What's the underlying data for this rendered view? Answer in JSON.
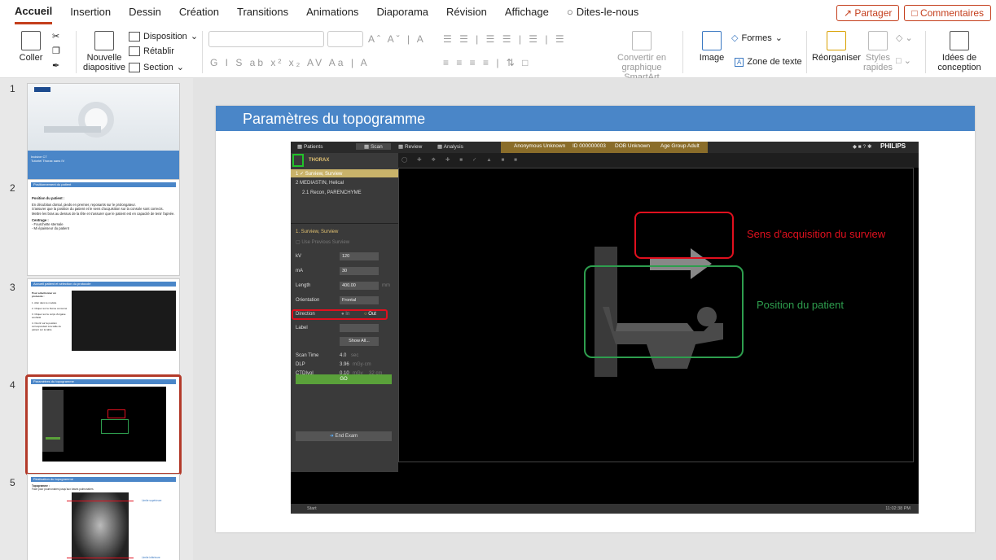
{
  "tabs": [
    "Accueil",
    "Insertion",
    "Dessin",
    "Création",
    "Transitions",
    "Animations",
    "Diaporama",
    "Révision",
    "Affichage",
    "Dites-le-nous"
  ],
  "top_buttons": {
    "share": "Partager",
    "comments": "Commentaires"
  },
  "ribbon": {
    "paste": "Coller",
    "new_slide_line1": "Nouvelle",
    "new_slide_line2": "diapositive",
    "layout": "Disposition",
    "reset": "Rétablir",
    "section": "Section",
    "format_row1": "Aˆ Aˇ | A",
    "format_row2": "G I S ab x² x₂ AV Aa | A",
    "smartart_line1": "Convertir en",
    "smartart_line2": "graphique SmartArt",
    "image": "Image",
    "shapes": "Formes",
    "textbox": "Zone de texte",
    "arrange": "Réorganiser",
    "quick_styles_line1": "Styles",
    "quick_styles_line2": "rapides",
    "design_line1": "Idées de",
    "design_line2": "conception"
  },
  "thumbnails": [
    {
      "num": "1",
      "lines": [
        "Incisive CT",
        "Tutoriel Thorax sans IV"
      ],
      "bar": ""
    },
    {
      "num": "2",
      "bar": "Positionnement du patient",
      "lines": [
        "Position du patient :",
        "En décubitus dorsal, pieds en premier, reposants sur le prolongateur.",
        "S'assurer que la position du patient et le sens d'acquisition sur la console sont corrects.",
        "Mettre les bras au dessus de la tête et s'assurer que le patient est en capacité de tenir l'apnée.",
        "Centrage :",
        "- Fourchette sternale",
        "- Mi épaisseur du patient"
      ]
    },
    {
      "num": "3",
      "bar": "Accueil patient et sélection du protocole",
      "lines": [
        "Pour sélectionner un protocole :",
        "1. Aller dans le modèle",
        "2. Cliquer sur le thème concerné",
        "3. Cliquer sur le corps d'organe souhaité",
        "4. Ouvrir sur la position correspondant à la taille du patient sur la table"
      ]
    },
    {
      "num": "4",
      "bar": "Paramètres du topogramme",
      "lines": []
    },
    {
      "num": "5",
      "bar": "Réalisation du topogramme",
      "lines": [
        "Topogramme :",
        "Face pour poumonaires jusqu'aux bases pulmonaires"
      ],
      "labels": [
        "Limite supérieure",
        "Limite inférieure"
      ]
    }
  ],
  "slide": {
    "title": "Paramètres du topogramme",
    "annotation_direction": "Sens d'acquisition du surview",
    "annotation_position": "Position du patient"
  },
  "scanner": {
    "tabs": {
      "patients": "Patients",
      "scan": "Scan",
      "review": "Review",
      "analysis": "Analysis"
    },
    "patient": {
      "name": "Anonymous Unknown",
      "id": "ID 000000003",
      "dob": "DOB Unknown",
      "age_group": "Age Group Adult"
    },
    "brand": "PHILIPS",
    "protocol": "THORAX",
    "series": [
      "1 ✓ Surview, Surview",
      "2  MEDIASTIN, Helical",
      "2.1 Recon, PARENCHYME"
    ],
    "section_title": "1. Surview, Surview",
    "use_previous": "Use Previous Surview",
    "params": [
      {
        "label": "kV",
        "value": "120"
      },
      {
        "label": "mA",
        "value": "30"
      },
      {
        "label": "Length",
        "value": "400.00"
      },
      {
        "label": "Orientation",
        "value": "Frontal"
      }
    ],
    "length_unit": "mm",
    "direction_label": "Direction",
    "direction_in": "In",
    "direction_out": "Out",
    "label_label": "Label",
    "show_all": "Show All...",
    "scan_time": {
      "label": "Scan Time",
      "value": "4.0",
      "unit": "sec"
    },
    "dlp": {
      "label": "DLP",
      "value": "3.96",
      "unit": "mGy·cm"
    },
    "ctdivol": {
      "label": "CTDIvol",
      "value": "0.10",
      "unit": "mGy",
      "phantom": "32 cm"
    },
    "go": "GO",
    "end_exam": "End Exam",
    "status_left": "Start",
    "status_right": "11:02:38 PM"
  },
  "colors": {
    "accent": "#c43e1c",
    "title_bar": "#4a86c8",
    "annot_red": "#e0101e",
    "annot_green": "#2e9e4e"
  }
}
